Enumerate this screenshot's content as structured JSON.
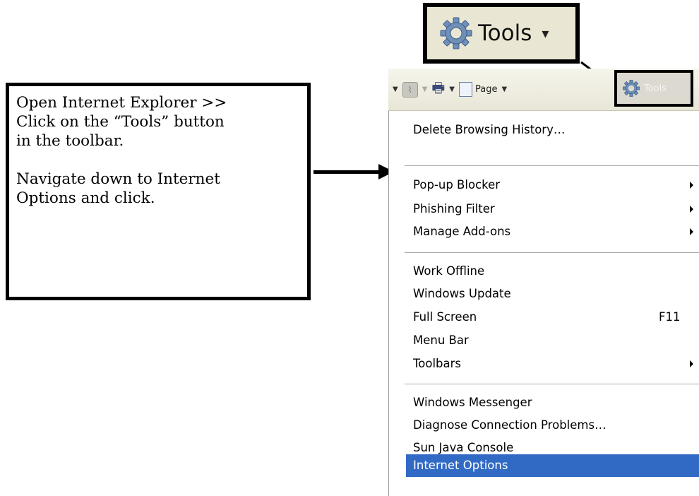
{
  "callout": {
    "line1": "Open Internet Explorer >>",
    "line2": "Click on the “Tools” button",
    "line3": "in the toolbar.",
    "line4": "Navigate down to Internet",
    "line5": "Options and click."
  },
  "zoom": {
    "tools_label": "Tools",
    "icon": "gear-icon"
  },
  "toolbar": {
    "page_label": "Page",
    "tools_label": "Tools"
  },
  "menu": {
    "delete_browsing": "Delete Browsing History…",
    "popup_blocker": "Pop-up Blocker",
    "phishing_filter": "Phishing Filter",
    "manage_addons": "Manage Add-ons",
    "work_offline": "Work Offline",
    "windows_update": "Windows Update",
    "full_screen": "Full Screen",
    "full_screen_shortcut": "F11",
    "menu_bar": "Menu Bar",
    "toolbars": "Toolbars",
    "windows_messenger": "Windows Messenger",
    "diagnose": "Diagnose Connection Problems…",
    "sun_java": "Sun Java Console",
    "internet_options": "Internet Options"
  },
  "colors": {
    "menu_highlight": "#316ac5",
    "toolbar_bg": "#e9e7d3"
  }
}
